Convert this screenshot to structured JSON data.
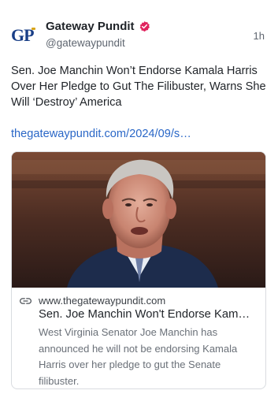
{
  "account": {
    "avatar_text": "GP",
    "name": "Gateway Pundit",
    "handle": "@gatewaypundit",
    "time": "1h",
    "verified_icon": "verified-badge-icon",
    "verified_color": "#e0245e"
  },
  "post": {
    "text": "Sen. Joe Manchin Won’t Endorse Kamala Harris Over Her Pledge to Gut The Filibuster, Warns She Will ‘Destroy’ America",
    "link": "thegatewaypundit.com/2024/09/s…"
  },
  "card": {
    "link_icon": "link-icon",
    "domain": "www.thegatewaypundit.com",
    "title": "Sen. Joe Manchin Won't Endorse Kamala Harris Over Her Pledge to Gut The Filibuster",
    "description": "West Virginia Senator Joe Manchin has announced he will not be endorsing Kamala Harris over her pledge to gut the Senate filibuster."
  },
  "colors": {
    "link": "#2a67c7",
    "brand": "#1a3f87"
  }
}
